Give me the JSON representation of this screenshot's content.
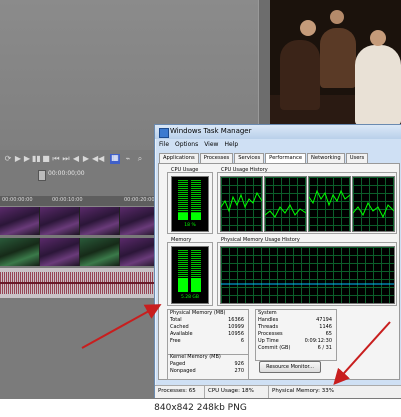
{
  "editor": {
    "timecode": "00:00:00;00",
    "ruler_labels": [
      "00:00:00:00",
      "00:00:10:00",
      "00:00:20:00"
    ]
  },
  "window": {
    "title": "Windows Task Manager",
    "menu": [
      "File",
      "Options",
      "View",
      "Help"
    ],
    "tabs": [
      "Applications",
      "Processes",
      "Services",
      "Performance",
      "Networking",
      "Users"
    ],
    "active_tab": "Performance",
    "groups": {
      "cpu_usage": "CPU Usage",
      "cpu_usage_history": "CPU Usage History",
      "memory": "Memory",
      "memory_history": "Physical Memory Usage History"
    },
    "cpu_meter_label": "18 %",
    "cpu_percent": 18,
    "memory_meter_label": "5.28 GB",
    "memory_percent": 33,
    "physical_memory": {
      "title": "Physical Memory (MB)",
      "rows": [
        {
          "label": "Total",
          "value": "16366"
        },
        {
          "label": "Cached",
          "value": "10999"
        },
        {
          "label": "Available",
          "value": "10956"
        },
        {
          "label": "Free",
          "value": "6"
        }
      ]
    },
    "kernel_memory": {
      "title": "Kernel Memory (MB)",
      "rows": [
        {
          "label": "Paged",
          "value": "926"
        },
        {
          "label": "Nonpaged",
          "value": "270"
        }
      ]
    },
    "system": {
      "title": "System",
      "rows": [
        {
          "label": "Handles",
          "value": "47194"
        },
        {
          "label": "Threads",
          "value": "1146"
        },
        {
          "label": "Processes",
          "value": "65"
        },
        {
          "label": "Up Time",
          "value": "0:09:12:30"
        },
        {
          "label": "Commit (GB)",
          "value": "6 / 31"
        }
      ]
    },
    "resource_monitor_button": "Resource Monitor...",
    "status": {
      "processes": "Processes: 65",
      "cpu": "CPU Usage: 18%",
      "memory": "Physical Memory: 33%"
    }
  },
  "caption": "840x842 248kb PNG",
  "colors": {
    "graph_green": "#00ff00",
    "arrow_red": "#c81e1e",
    "title_blue": "#b9d0ea"
  }
}
